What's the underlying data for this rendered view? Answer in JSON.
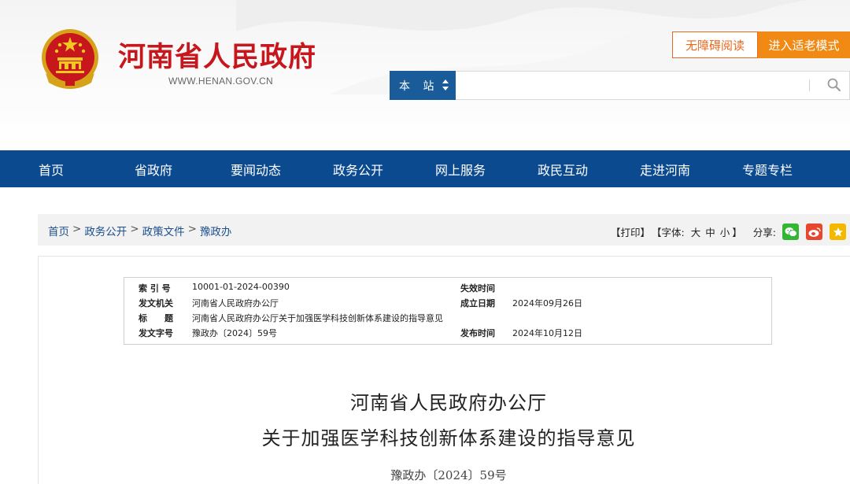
{
  "header": {
    "site_name": "河南省人民政府",
    "site_url": "WWW.HENAN.GOV.CN",
    "accessibility_button": "无障碍阅读",
    "elder_mode_button": "进入适老模式",
    "emblem_icon": "national-emblem-icon",
    "brand_color": "#c8161d"
  },
  "search": {
    "scope": "本 站",
    "placeholder": "",
    "icon": "search-icon"
  },
  "nav": {
    "items": [
      "首页",
      "省政府",
      "要闻动态",
      "政务公开",
      "网上服务",
      "政民互动",
      "走进河南",
      "专题专栏"
    ],
    "background": "#0b4a8e"
  },
  "breadcrumb": {
    "items": [
      "首页",
      "政务公开",
      "政策文件",
      "豫政办"
    ],
    "separator": ">"
  },
  "tools": {
    "print": "【打印】",
    "font_label": "【字体:",
    "font_large": "大",
    "font_medium": "中",
    "font_small": "小",
    "font_close": "】",
    "share_label": "分享:",
    "share_icons": [
      "wechat-icon",
      "weibo-icon",
      "qzone-icon"
    ]
  },
  "meta": {
    "index_label": "索 引 号",
    "index_value": "10001-01-2024-00390",
    "expire_label": "失效时间",
    "expire_value": "",
    "issuer_label": "发文机关",
    "issuer_value": "河南省人民政府办公厅",
    "created_label": "成立日期",
    "created_value": "2024年09月26日",
    "title_label": "标　　题",
    "title_value": "河南省人民政府办公厅关于加强医学科技创新体系建设的指导意见",
    "docno_label": "发文字号",
    "docno_value": "豫政办〔2024〕59号",
    "publish_label": "发布时间",
    "publish_value": "2024年10月12日"
  },
  "document": {
    "title_line1": "河南省人民政府办公厅",
    "title_line2": "关于加强医学科技创新体系建设的指导意见",
    "doc_number": "豫政办〔2024〕59号"
  }
}
